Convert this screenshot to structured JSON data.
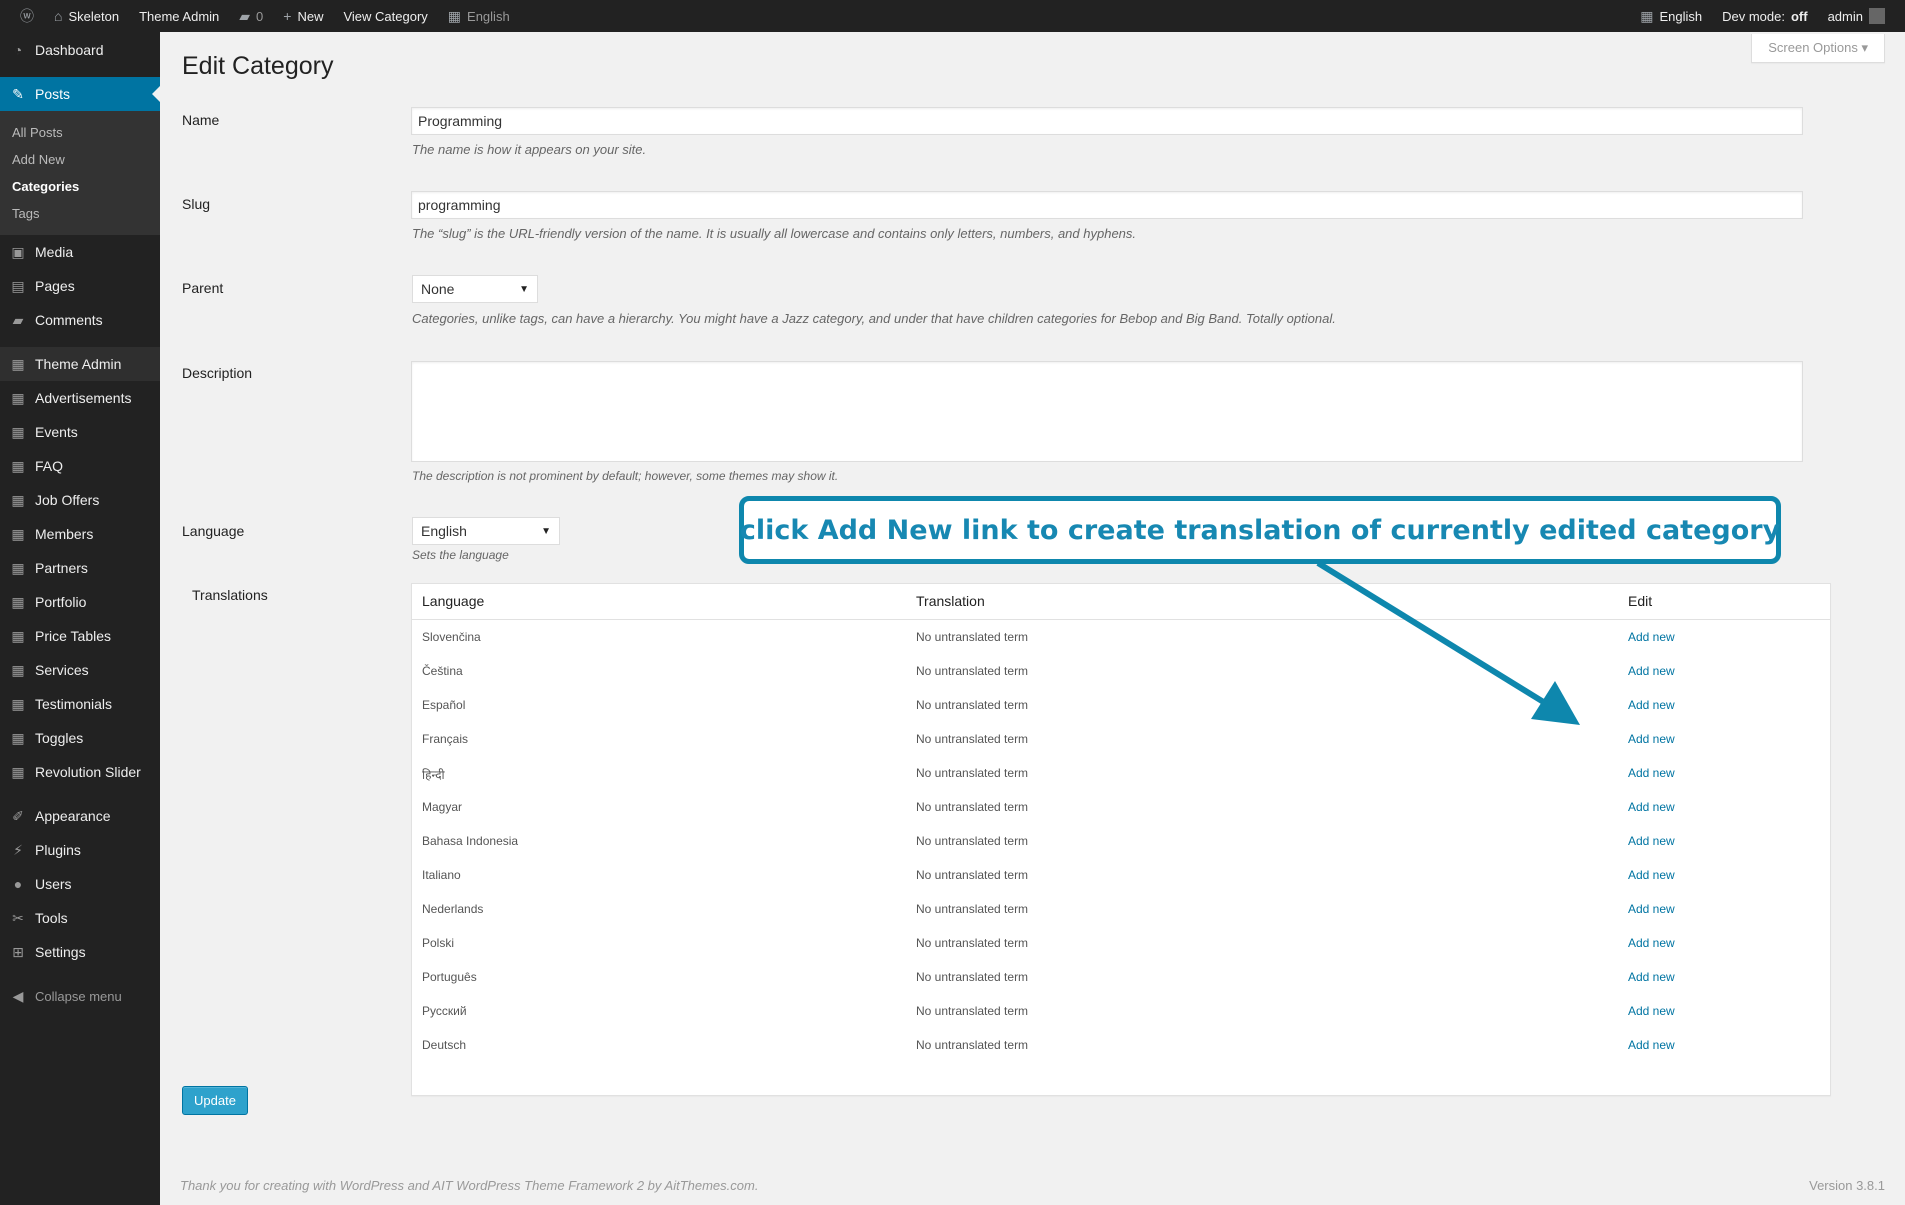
{
  "adminbar": {
    "left": [
      {
        "icon": "wordpress-logo-icon",
        "label": ""
      },
      {
        "icon": "home-icon",
        "label": "Skeleton"
      },
      {
        "icon": "",
        "label": "Theme Admin"
      },
      {
        "icon": "comment-icon",
        "label": "0"
      },
      {
        "icon": "plus-icon",
        "label": "New"
      },
      {
        "icon": "",
        "label": "View Category"
      },
      {
        "icon": "flag-icon",
        "label": "English"
      }
    ],
    "right": {
      "language": "English",
      "dev_mode_label": "Dev mode:",
      "dev_mode_value": "off",
      "user": "admin"
    }
  },
  "sidebar": {
    "dashboard": "Dashboard",
    "posts": "Posts",
    "posts_sub": [
      "All Posts",
      "Add New",
      "Categories",
      "Tags"
    ],
    "group2": [
      "Media",
      "Pages",
      "Comments"
    ],
    "group3": [
      "Theme Admin",
      "Advertisements",
      "Events",
      "FAQ",
      "Job Offers",
      "Members",
      "Partners",
      "Portfolio",
      "Price Tables",
      "Services",
      "Testimonials",
      "Toggles",
      "Revolution Slider"
    ],
    "group4": [
      "Appearance",
      "Plugins",
      "Users",
      "Tools",
      "Settings"
    ],
    "collapse": "Collapse menu"
  },
  "screen_options": "Screen Options",
  "page_title": "Edit Category",
  "form": {
    "name_label": "Name",
    "name_value": "Programming",
    "name_hint": "The name is how it appears on your site.",
    "slug_label": "Slug",
    "slug_value": "programming",
    "slug_hint": "The “slug” is the URL-friendly version of the name. It is usually all lowercase and contains only letters, numbers, and hyphens.",
    "parent_label": "Parent",
    "parent_value": "None",
    "parent_hint": "Categories, unlike tags, can have a hierarchy. You might have a Jazz category, and under that have children categories for Bebop and Big Band. Totally optional.",
    "description_label": "Description",
    "description_value": "",
    "description_hint": "The description is not prominent by default; however, some themes may show it.",
    "language_label": "Language",
    "language_value": "English",
    "language_hint": "Sets the language",
    "translations_label": "Translations"
  },
  "translations": {
    "headers": [
      "Language",
      "Translation",
      "Edit"
    ],
    "rows": [
      {
        "language": "Slovenčina",
        "translation": "No untranslated term",
        "edit": "Add new"
      },
      {
        "language": "Čeština",
        "translation": "No untranslated term",
        "edit": "Add new"
      },
      {
        "language": "Español",
        "translation": "No untranslated term",
        "edit": "Add new"
      },
      {
        "language": "Français",
        "translation": "No untranslated term",
        "edit": "Add new"
      },
      {
        "language": "हिन्दी",
        "translation": "No untranslated term",
        "edit": "Add new"
      },
      {
        "language": "Magyar",
        "translation": "No untranslated term",
        "edit": "Add new"
      },
      {
        "language": "Bahasa Indonesia",
        "translation": "No untranslated term",
        "edit": "Add new"
      },
      {
        "language": "Italiano",
        "translation": "No untranslated term",
        "edit": "Add new"
      },
      {
        "language": "Nederlands",
        "translation": "No untranslated term",
        "edit": "Add new"
      },
      {
        "language": "Polski",
        "translation": "No untranslated term",
        "edit": "Add new"
      },
      {
        "language": "Português",
        "translation": "No untranslated term",
        "edit": "Add new"
      },
      {
        "language": "Русский",
        "translation": "No untranslated term",
        "edit": "Add new"
      },
      {
        "language": "Deutsch",
        "translation": "No untranslated term",
        "edit": "Add new"
      }
    ]
  },
  "update_button": "Update",
  "footer": {
    "left": "Thank you for creating with WordPress and AIT WordPress Theme Framework 2 by AitThemes.com.",
    "right": "Version 3.8.1"
  },
  "callout": "click Add New link to create translation of currently edited category",
  "colors": {
    "accent": "#0074a2",
    "callout": "#0e87ad",
    "button": "#2ea2cc"
  }
}
